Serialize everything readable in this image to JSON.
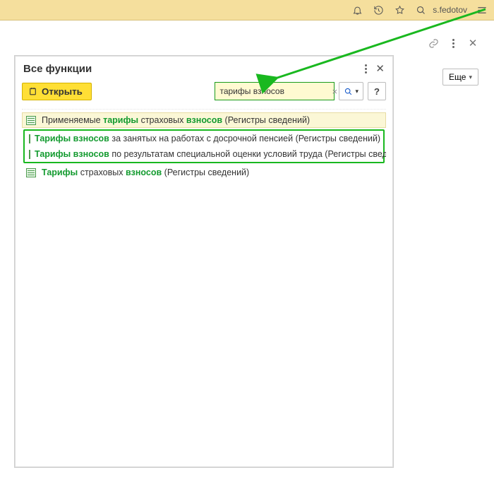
{
  "topbar": {
    "username": "s.fedotov"
  },
  "subbar": {},
  "more_button": {
    "label": "Еще"
  },
  "panel": {
    "title": "Все функции",
    "open_label": "Открыть",
    "help_label": "?",
    "search": {
      "value": "тарифы взносов"
    }
  },
  "results": [
    {
      "prefix": "Применяемые ",
      "hl": "тарифы",
      "mid": " страховых ",
      "hl2": "взносов",
      "suffix": " (Регистры сведений)"
    },
    {
      "prefix": "",
      "hl": "Тарифы взносов",
      "mid": " за занятых на работах с досрочной пенсией ",
      "hl2": "",
      "suffix": "(Регистры сведений)"
    },
    {
      "prefix": "",
      "hl": "Тарифы взносов",
      "mid": " по результатам специальной оценки условий труда ",
      "hl2": "",
      "suffix": "(Регистры сведений)"
    },
    {
      "prefix": "",
      "hl": "Тарифы",
      "mid": " страховых ",
      "hl2": "взносов",
      "suffix": " (Регистры сведений)"
    }
  ]
}
